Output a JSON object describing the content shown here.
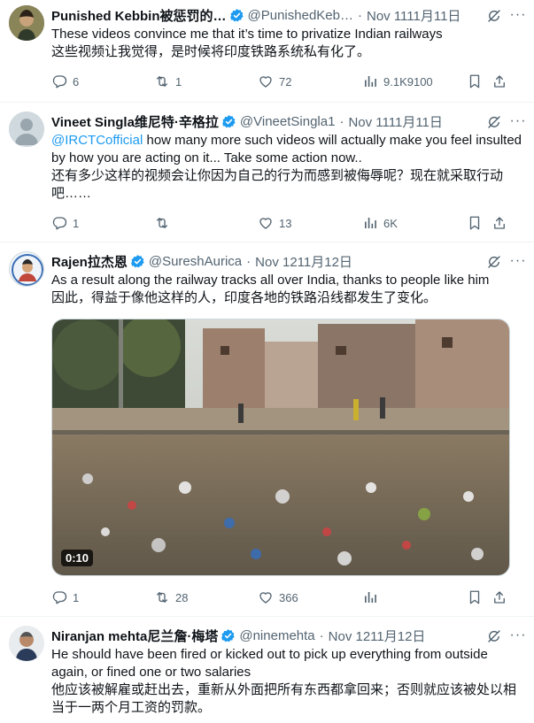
{
  "tweets": [
    {
      "name": "Punished Kebbin被惩罚的…",
      "handle": "@PunishedKeb…",
      "date": "Nov 1111月11日",
      "text_en": "These videos convince me that it’s time to privatize Indian railways",
      "text_cn": "这些视频让我觉得，是时候将印度铁路系统私有化了。",
      "replies": "6",
      "reposts": "1",
      "likes": "72",
      "views": "9.1K9100"
    },
    {
      "name": "Vineet Singla维尼特·辛格拉",
      "handle": "@VineetSingla1",
      "date": "Nov 1111月11日",
      "mention": "@IRCTCofficial",
      "text_en_rest": " how many more such videos will actually make you feel insulted by how you are acting on it... Take some action now..",
      "text_cn": "还有多少这样的视频会让你因为自己的行为而感到被侮辱呢？现在就采取行动吧……",
      "replies": "1",
      "reposts": "",
      "likes": "13",
      "views": "6K"
    },
    {
      "name": "Rajen拉杰恩",
      "handle": "@SureshAurica",
      "date": "Nov 1211月12日",
      "text_en": "As a result along the railway tracks all over India, thanks to people like him",
      "text_cn": "因此，得益于像他这样的人，印度各地的铁路沿线都发生了变化。",
      "video_duration": "0:10",
      "replies": "1",
      "reposts": "28",
      "likes": "366",
      "views": ""
    },
    {
      "name": "Niranjan mehta尼兰詹·梅塔",
      "handle": "@ninemehta",
      "date": "Nov 1211月12日",
      "text_en": "He should have been fired or kicked out to pick up everything from outside again, or fined one or two salaries",
      "text_cn": "他应该被解雇或赶出去，重新从外面把所有东西都拿回来；否则就应该被处以相当于一两个月工资的罚款。"
    }
  ],
  "colors": {
    "accent": "#1d9bf0",
    "secondary_text": "#536471",
    "verified_badge": "#1d9bf0"
  },
  "icons": [
    "reply-icon",
    "repost-icon",
    "like-icon",
    "views-icon",
    "bookmark-icon",
    "share-icon",
    "grok-icon",
    "more-icon",
    "verified-icon"
  ]
}
